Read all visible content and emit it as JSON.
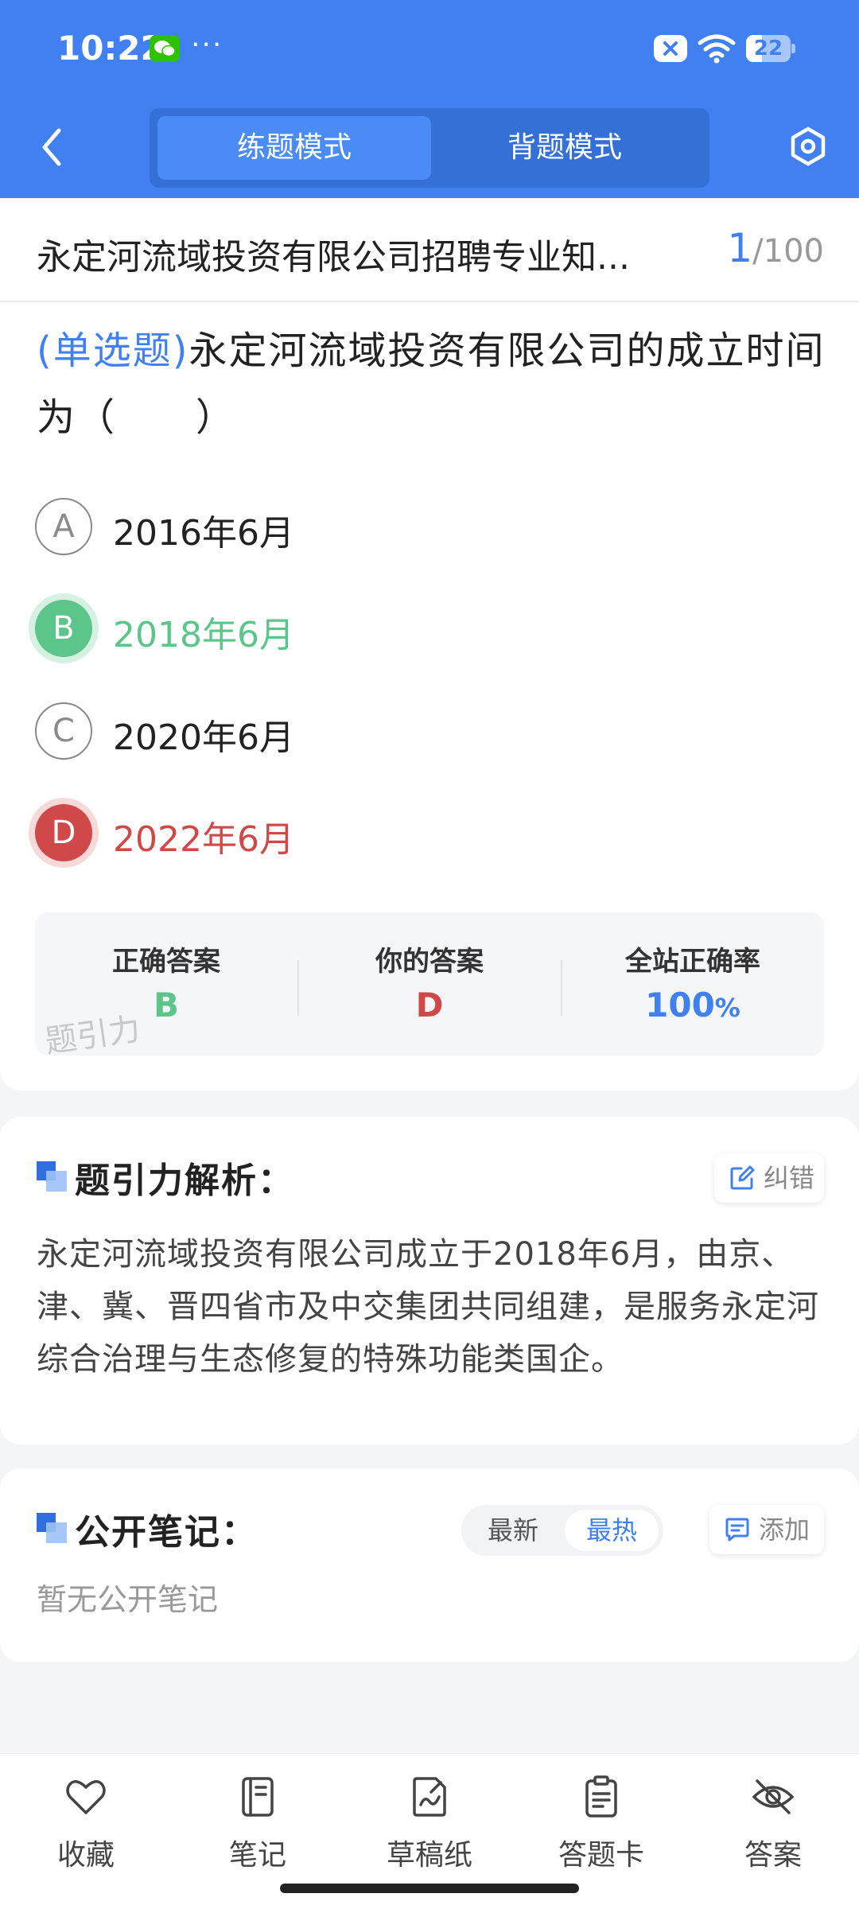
{
  "status": {
    "time": "10:22",
    "more": "···",
    "battery": "22"
  },
  "header": {
    "tabs": [
      {
        "label": "练题模式",
        "active": true
      },
      {
        "label": "背题模式",
        "active": false
      }
    ]
  },
  "paper": {
    "title": "永定河流域投资有限公司招聘专业知...",
    "current": "1",
    "total": "/100"
  },
  "question": {
    "type": "(单选题)",
    "text": "永定河流域投资有限公司的成立时间为（　　）",
    "options": [
      {
        "letter": "A",
        "text": "2016年6月",
        "state": "normal"
      },
      {
        "letter": "B",
        "text": "2018年6月",
        "state": "correct"
      },
      {
        "letter": "C",
        "text": "2020年6月",
        "state": "normal"
      },
      {
        "letter": "D",
        "text": "2022年6月",
        "state": "wrong"
      }
    ]
  },
  "result": {
    "correct_label": "正确答案",
    "correct_value": "B",
    "yours_label": "你的答案",
    "yours_value": "D",
    "rate_label": "全站正确率",
    "rate_value": "100",
    "rate_unit": "%",
    "watermark": "题引力"
  },
  "analysis": {
    "title": "题引力解析：",
    "report_label": "纠错",
    "text": "永定河流域投资有限公司成立于2018年6月，由京、津、冀、晋四省市及中交集团共同组建，是服务永定河综合治理与生态修复的特殊功能类国企。"
  },
  "notes": {
    "title": "公开笔记：",
    "sort": [
      "最新",
      "最热"
    ],
    "add_label": "添加",
    "empty": "暂无公开笔记"
  },
  "bottom_bar": [
    {
      "label": "收藏",
      "icon": "heart-icon"
    },
    {
      "label": "笔记",
      "icon": "notebook-icon"
    },
    {
      "label": "草稿纸",
      "icon": "draft-icon"
    },
    {
      "label": "答题卡",
      "icon": "answer-sheet-icon"
    },
    {
      "label": "答案",
      "icon": "eye-off-icon"
    }
  ],
  "colors": {
    "primary": "#4080f0",
    "correct": "#5cc58a",
    "wrong": "#d04848"
  }
}
